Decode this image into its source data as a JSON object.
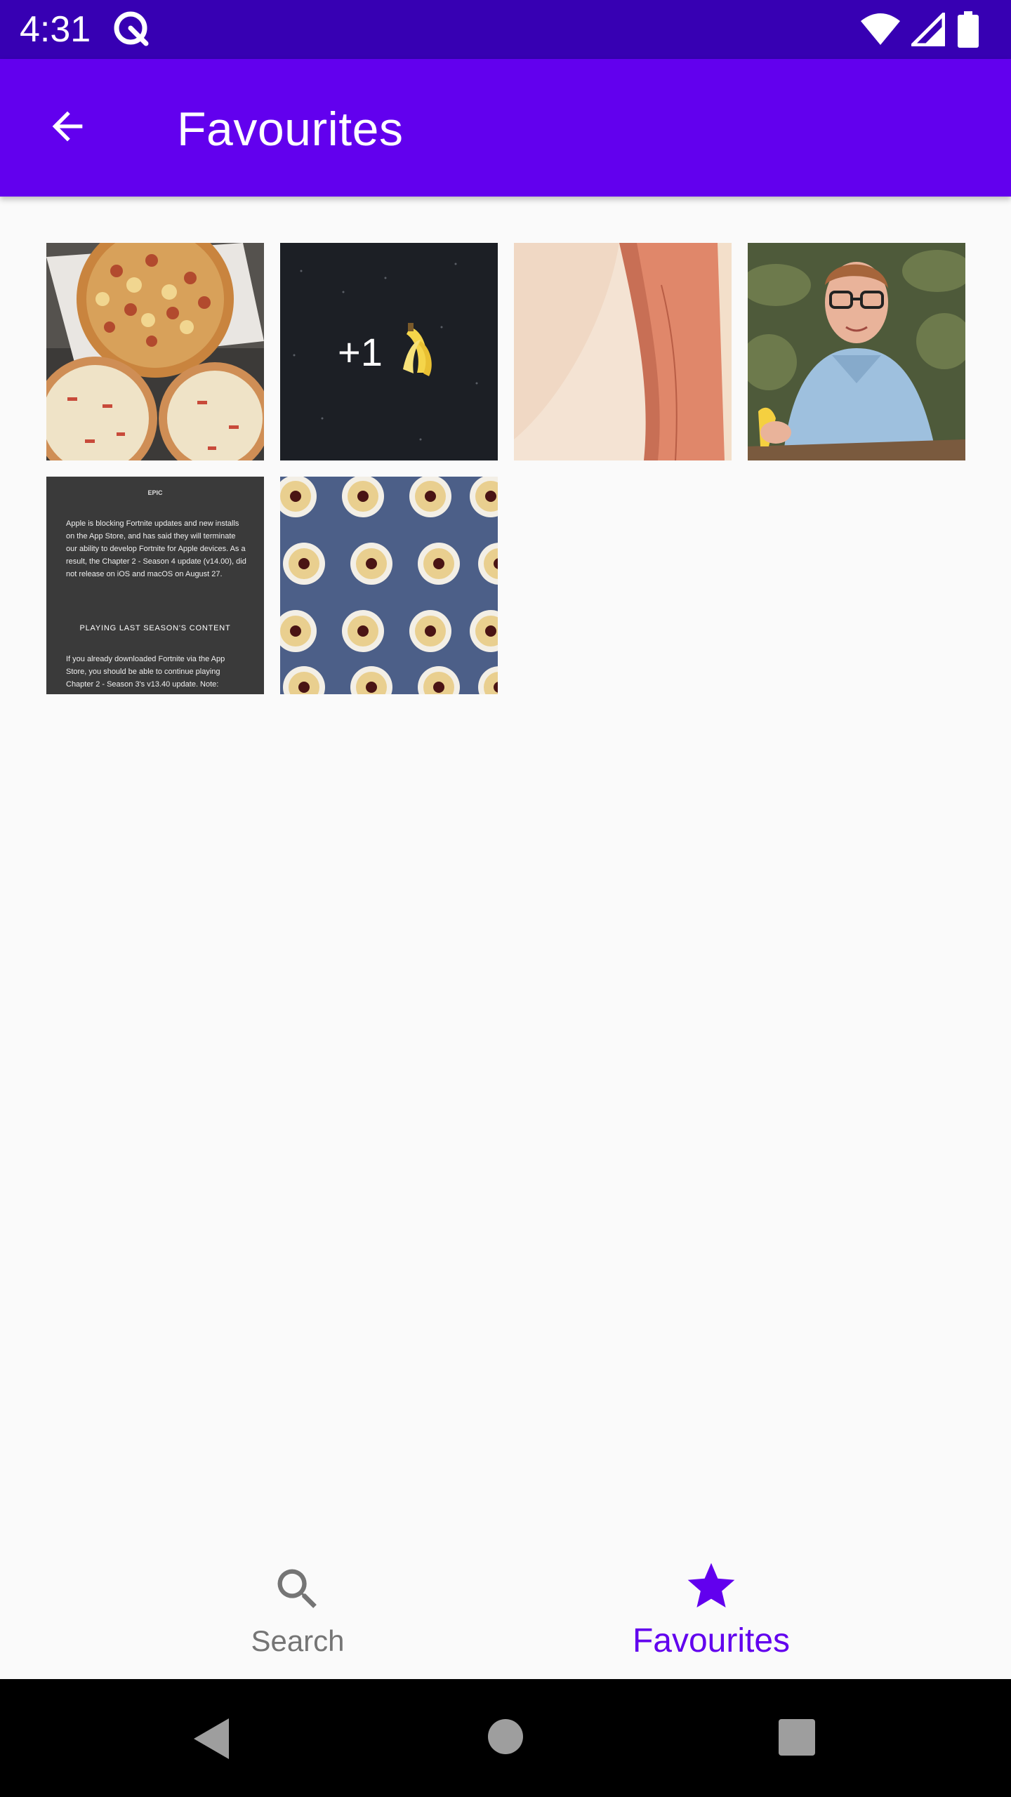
{
  "status_bar": {
    "time": "4:31"
  },
  "app_bar": {
    "title": "Favourites",
    "back_icon": "arrow-back-icon"
  },
  "grid": {
    "items": [
      {
        "name": "pizza",
        "desc": "pizzas"
      },
      {
        "name": "plus-one-banana",
        "overlay_text": "+1"
      },
      {
        "name": "anime-still"
      },
      {
        "name": "man-with-banana"
      },
      {
        "name": "fortnite-notice",
        "logo": "EPIC",
        "paragraph1": "Apple is blocking Fortnite updates and new installs on the App Store, and has said they will terminate our ability to develop Fortnite for Apple devices. As a result, the Chapter 2 - Season 4 update (v14.00), did not release on iOS and macOS on August 27.",
        "heading": "PLAYING LAST SEASON'S CONTENT",
        "paragraph2": "If you already downloaded Fortnite via the App Store, you should be able to continue playing Chapter 2 - Season 3's v13.40 update. Note:"
      },
      {
        "name": "jam-cookies"
      }
    ]
  },
  "bottom_nav": {
    "search_label": "Search",
    "favourites_label": "Favourites",
    "active": "favourites",
    "active_color": "#6200ee",
    "inactive_color": "#757575"
  },
  "colors": {
    "status_bar": "#3700b3",
    "app_bar": "#6200ee",
    "background": "#fafafa"
  }
}
